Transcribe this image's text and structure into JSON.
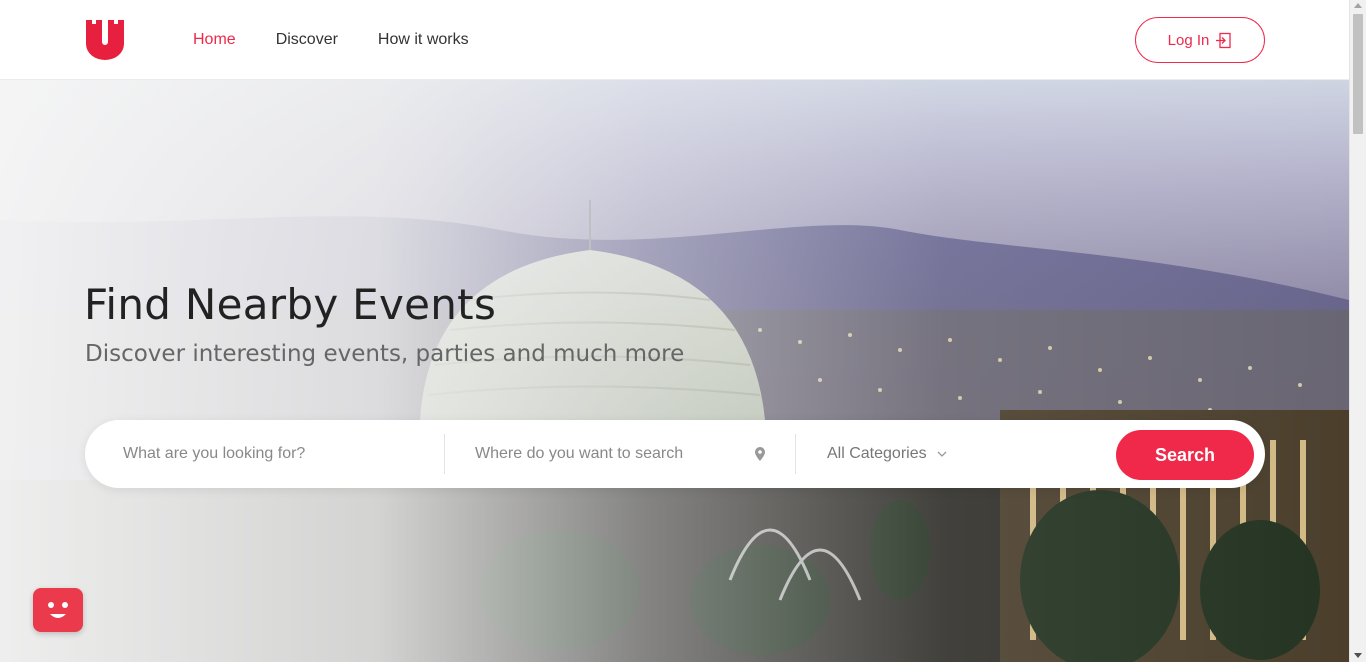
{
  "header": {
    "nav": [
      {
        "label": "Home",
        "active": true
      },
      {
        "label": "Discover",
        "active": false
      },
      {
        "label": "How it works",
        "active": false
      }
    ],
    "login_label": "Log In"
  },
  "hero": {
    "title": "Find Nearby Events",
    "subtitle": "Discover interesting events, parties and much more"
  },
  "search": {
    "what_placeholder": "What are you looking for?",
    "where_placeholder": "Where do you want to search",
    "category_selected": "All Categories",
    "button_label": "Search"
  },
  "icons": {
    "logo": "logo-icon",
    "login": "login-icon",
    "location": "map-pin-icon",
    "dropdown": "chevron-down-icon",
    "chat": "chat-widget-icon"
  },
  "colors": {
    "accent": "#f0284a",
    "text_dark": "#222222",
    "text_muted": "#666666"
  }
}
